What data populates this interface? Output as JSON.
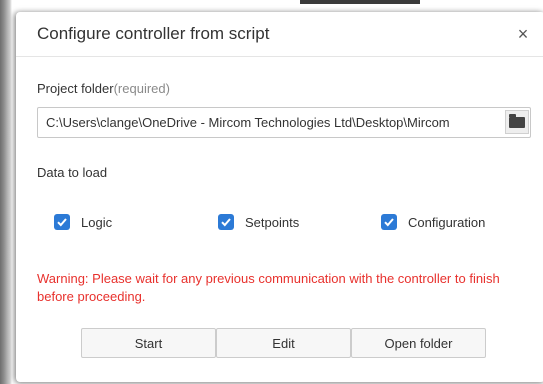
{
  "dialog": {
    "title": "Configure controller from script",
    "close_glyph": "×"
  },
  "project_folder": {
    "label": "Project folder",
    "required_note": "(required)",
    "value": "C:\\Users\\clange\\OneDrive - Mircom Technologies Ltd\\Desktop\\Mircom",
    "browse_icon": "folder-icon"
  },
  "data_to_load": {
    "label": "Data to load",
    "options": [
      {
        "label": "Logic",
        "checked": true
      },
      {
        "label": "Setpoints",
        "checked": true
      },
      {
        "label": "Configuration",
        "checked": true
      }
    ]
  },
  "warning": {
    "text": "Warning: Please wait for any previous communication with the controller to finish before proceeding."
  },
  "buttons": {
    "start": "Start",
    "edit": "Edit",
    "open_folder": "Open folder"
  },
  "colors": {
    "accent": "#2c7ad6",
    "warning": "#e8312d"
  }
}
